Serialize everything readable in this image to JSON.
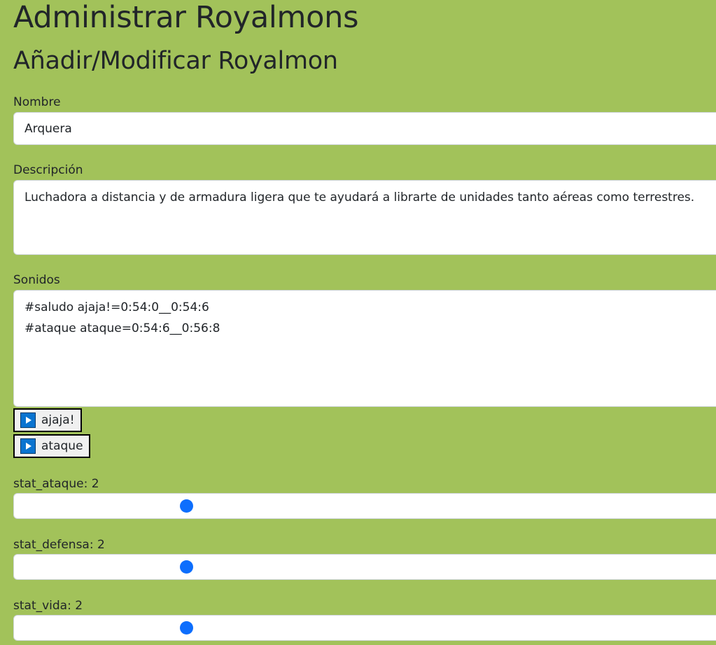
{
  "page": {
    "title": "Administrar Royalmons",
    "subtitle": "Añadir/Modificar Royalmon"
  },
  "form": {
    "nombre": {
      "label": "Nombre",
      "value": "Arquera"
    },
    "descripcion": {
      "label": "Descripción",
      "value": "Luchadora a distancia y de armadura ligera que te ayudará a librarte de unidades tanto aéreas como terrestres."
    },
    "sonidos": {
      "label": "Sonidos",
      "value": "#saludo ajaja!=0:54:0__0:54:6\n#ataque ataque=0:54:6__0:56:8"
    },
    "sound_buttons": [
      {
        "label": "ajaja!",
        "icon": "play-icon"
      },
      {
        "label": "ataque",
        "icon": "play-icon"
      }
    ],
    "stats": [
      {
        "label": "stat_ataque: 2",
        "value": 2
      },
      {
        "label": "stat_defensa: 2",
        "value": 2
      },
      {
        "label": "stat_vida: 2",
        "value": 2
      }
    ]
  },
  "colors": {
    "background": "#a2c25a",
    "accent": "#0d6efd",
    "play_icon": "#0a74d0"
  }
}
